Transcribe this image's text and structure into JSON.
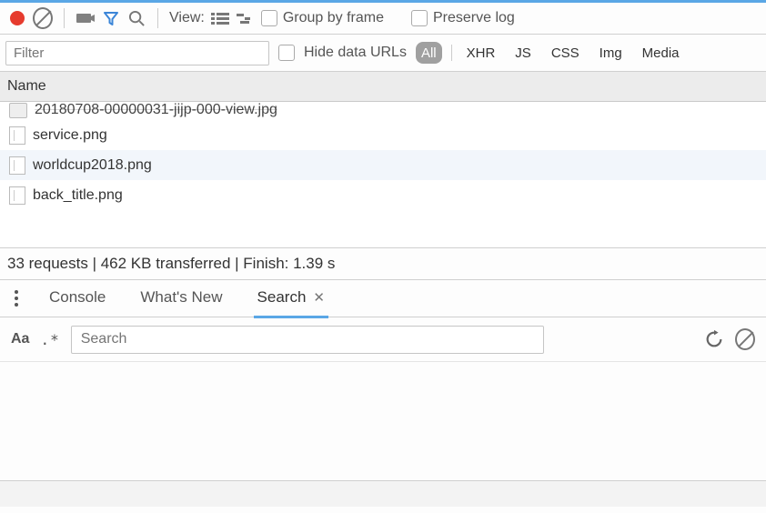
{
  "toolbar": {
    "view_label": "View:",
    "group_by_frame_label": "Group by frame",
    "preserve_log_label": "Preserve log"
  },
  "filterbar": {
    "filter_placeholder": "Filter",
    "hide_data_urls_label": "Hide data URLs",
    "types": [
      "All",
      "XHR",
      "JS",
      "CSS",
      "Img",
      "Media"
    ],
    "selected_type_index": 0
  },
  "columns": {
    "name": "Name"
  },
  "rows": [
    {
      "name": "20180708-00000031-jijp-000-view.jpg",
      "icon": "img",
      "cut": true
    },
    {
      "name": "service.png",
      "icon": "blank"
    },
    {
      "name": "worldcup2018.png",
      "icon": "blank",
      "alt": true
    },
    {
      "name": "back_title.png",
      "icon": "blank"
    }
  ],
  "status": {
    "requests": "33 requests",
    "transferred": "462 KB transferred",
    "finish": "Finish: 1.39 s"
  },
  "drawer": {
    "tabs": [
      "Console",
      "What's New",
      "Search"
    ],
    "selected_index": 2
  },
  "search": {
    "case_label": "Aa",
    "regex_label": ".*",
    "placeholder": "Search"
  }
}
